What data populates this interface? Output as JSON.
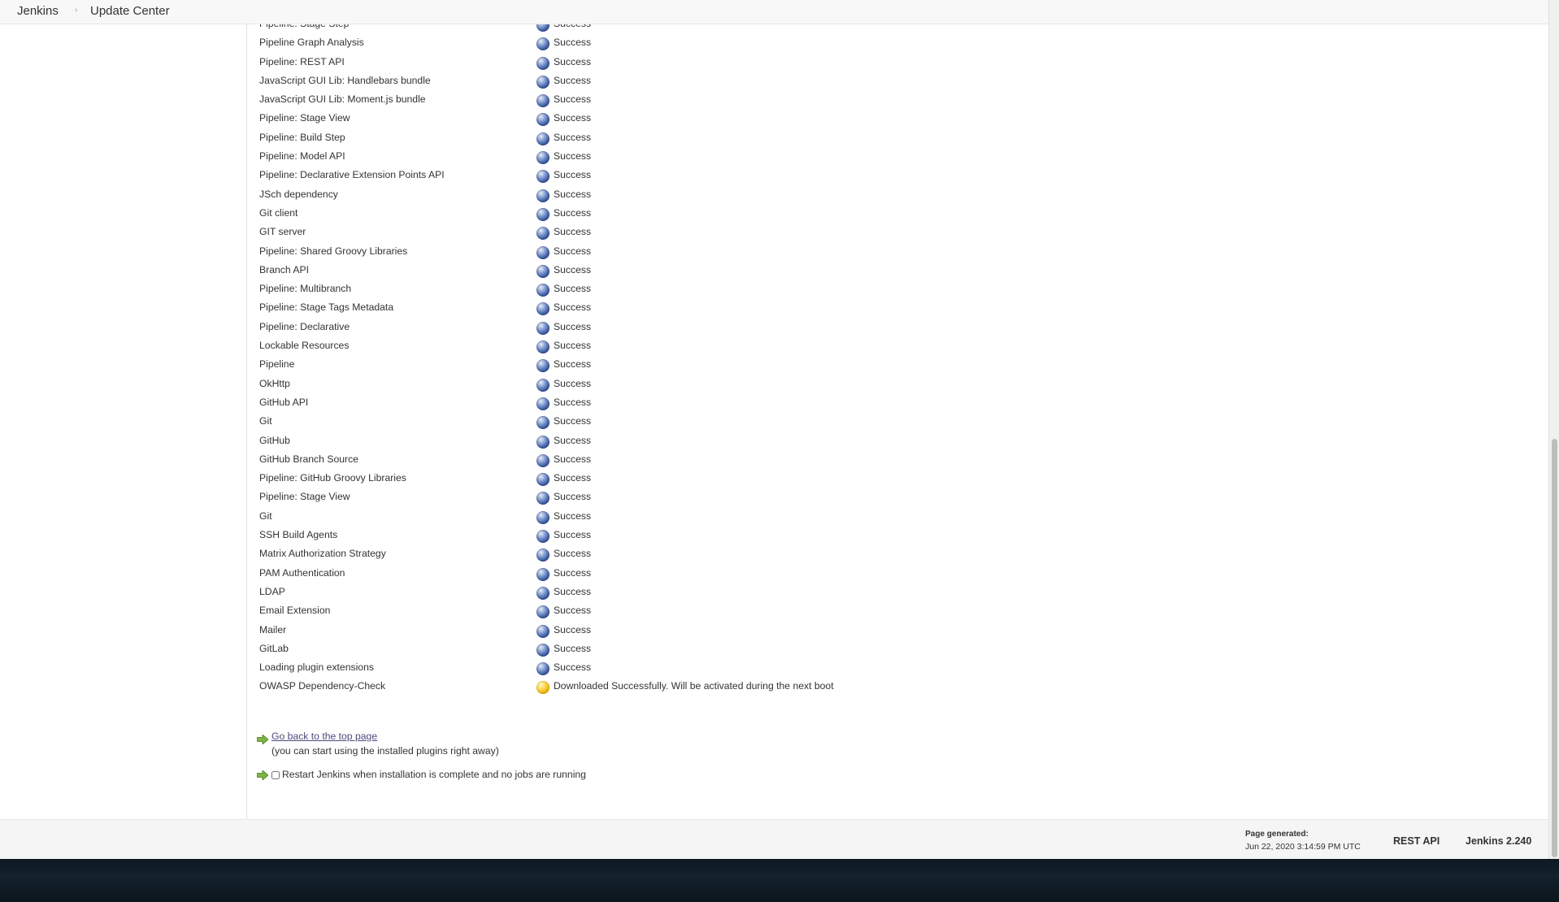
{
  "breadcrumbs": {
    "home": "Jenkins",
    "separator": "›",
    "current": "Update Center"
  },
  "install_list": [
    {
      "name": "Pipeline: Stage Step",
      "status": "Success",
      "state": "success"
    },
    {
      "name": "Pipeline Graph Analysis",
      "status": "Success",
      "state": "success"
    },
    {
      "name": "Pipeline: REST API",
      "status": "Success",
      "state": "success"
    },
    {
      "name": "JavaScript GUI Lib: Handlebars bundle",
      "status": "Success",
      "state": "success"
    },
    {
      "name": "JavaScript GUI Lib: Moment.js bundle",
      "status": "Success",
      "state": "success"
    },
    {
      "name": "Pipeline: Stage View",
      "status": "Success",
      "state": "success"
    },
    {
      "name": "Pipeline: Build Step",
      "status": "Success",
      "state": "success"
    },
    {
      "name": "Pipeline: Model API",
      "status": "Success",
      "state": "success"
    },
    {
      "name": "Pipeline: Declarative Extension Points API",
      "status": "Success",
      "state": "success"
    },
    {
      "name": "JSch dependency",
      "status": "Success",
      "state": "success"
    },
    {
      "name": "Git client",
      "status": "Success",
      "state": "success"
    },
    {
      "name": "GIT server",
      "status": "Success",
      "state": "success"
    },
    {
      "name": "Pipeline: Shared Groovy Libraries",
      "status": "Success",
      "state": "success"
    },
    {
      "name": "Branch API",
      "status": "Success",
      "state": "success"
    },
    {
      "name": "Pipeline: Multibranch",
      "status": "Success",
      "state": "success"
    },
    {
      "name": "Pipeline: Stage Tags Metadata",
      "status": "Success",
      "state": "success"
    },
    {
      "name": "Pipeline: Declarative",
      "status": "Success",
      "state": "success"
    },
    {
      "name": "Lockable Resources",
      "status": "Success",
      "state": "success"
    },
    {
      "name": "Pipeline",
      "status": "Success",
      "state": "success"
    },
    {
      "name": "OkHttp",
      "status": "Success",
      "state": "success"
    },
    {
      "name": "GitHub API",
      "status": "Success",
      "state": "success"
    },
    {
      "name": "Git",
      "status": "Success",
      "state": "success"
    },
    {
      "name": "GitHub",
      "status": "Success",
      "state": "success"
    },
    {
      "name": "GitHub Branch Source",
      "status": "Success",
      "state": "success"
    },
    {
      "name": "Pipeline: GitHub Groovy Libraries",
      "status": "Success",
      "state": "success"
    },
    {
      "name": "Pipeline: Stage View",
      "status": "Success",
      "state": "success"
    },
    {
      "name": "Git",
      "status": "Success",
      "state": "success"
    },
    {
      "name": "SSH Build Agents",
      "status": "Success",
      "state": "success"
    },
    {
      "name": "Matrix Authorization Strategy",
      "status": "Success",
      "state": "success"
    },
    {
      "name": "PAM Authentication",
      "status": "Success",
      "state": "success"
    },
    {
      "name": "LDAP",
      "status": "Success",
      "state": "success"
    },
    {
      "name": "Email Extension",
      "status": "Success",
      "state": "success"
    },
    {
      "name": "Mailer",
      "status": "Success",
      "state": "success"
    },
    {
      "name": "GitLab",
      "status": "Success",
      "state": "success"
    },
    {
      "name": "Loading plugin extensions",
      "status": "Success",
      "state": "success"
    },
    {
      "name": "OWASP Dependency-Check",
      "status": "Downloaded Successfully. Will be activated during the next boot",
      "state": "pending"
    }
  ],
  "actions": {
    "back_link": "Go back to the top page",
    "back_hint": "(you can start using the installed plugins right away)",
    "restart_label": "Restart Jenkins when installation is complete and no jobs are running",
    "restart_checked": false
  },
  "footer": {
    "page_generated_label": "Page generated:",
    "page_generated_value": "Jun 22, 2020 3:14:59 PM UTC",
    "rest_api": "REST API",
    "version": "Jenkins 2.240"
  },
  "colors": {
    "success_ball": "#3b5aa1",
    "pending_ball": "#ffd84d",
    "link": "#4a4a7c",
    "arrow": "#7cb342"
  },
  "icons": {
    "success": "blue-ball-icon",
    "pending": "yellow-ball-icon",
    "action": "green-arrow-icon"
  }
}
